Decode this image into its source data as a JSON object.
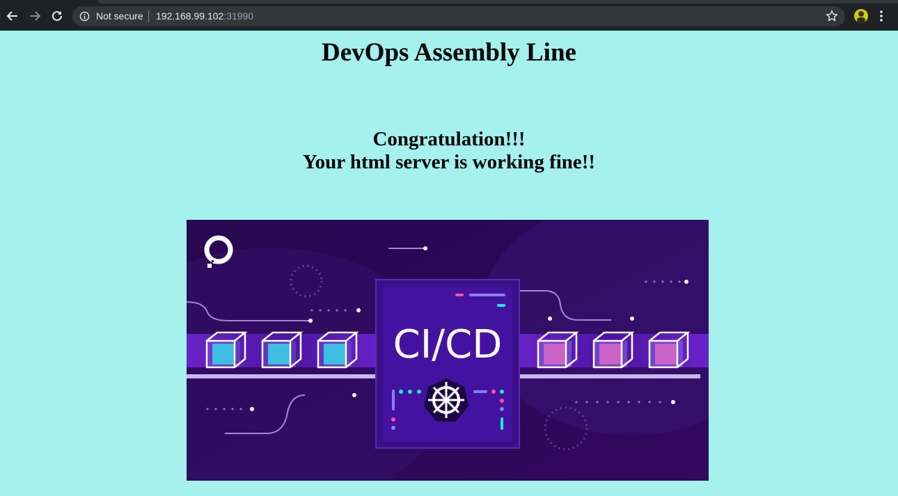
{
  "browser": {
    "security_label": "Not secure",
    "url_host": "192.168.99.102",
    "url_port": ":31990"
  },
  "page": {
    "title": "DevOps Assembly Line",
    "message_line1": "Congratulation!!!",
    "message_line2": "Your html server is working fine!!"
  },
  "banner": {
    "text": "CI/CD",
    "logo_icon": "digitalocean-logo-icon",
    "center_icon": "kubernetes-helm-icon",
    "colors": {
      "background": "#2b0a5c",
      "cyan": "#1de9e0",
      "pink": "#ff4fa8"
    }
  },
  "colors": {
    "page_background": "#a4f1ee",
    "browser_chrome": "#202124"
  }
}
